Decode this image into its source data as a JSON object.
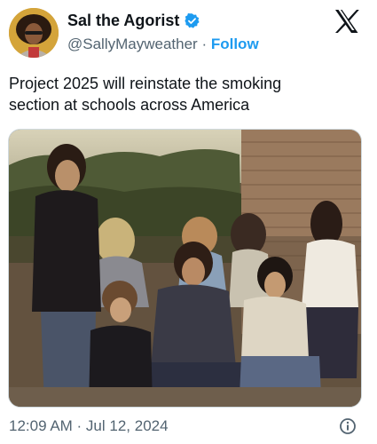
{
  "author": {
    "display_name": "Sal the Agorist",
    "handle": "@SallyMayweather",
    "separator": "·",
    "follow_label": "Follow",
    "verified": true
  },
  "tweet": {
    "text": "Project 2025 will reinstate the smoking\nsection at schools across America",
    "timestamp": "12:09 AM · Jul 12, 2024"
  },
  "icons": {
    "logo": "x-logo-icon",
    "verified": "verified-badge-icon",
    "info": "info-icon"
  },
  "colors": {
    "link": "#1d9bf0",
    "secondary_text": "#536471",
    "primary_text": "#0f1419"
  }
}
